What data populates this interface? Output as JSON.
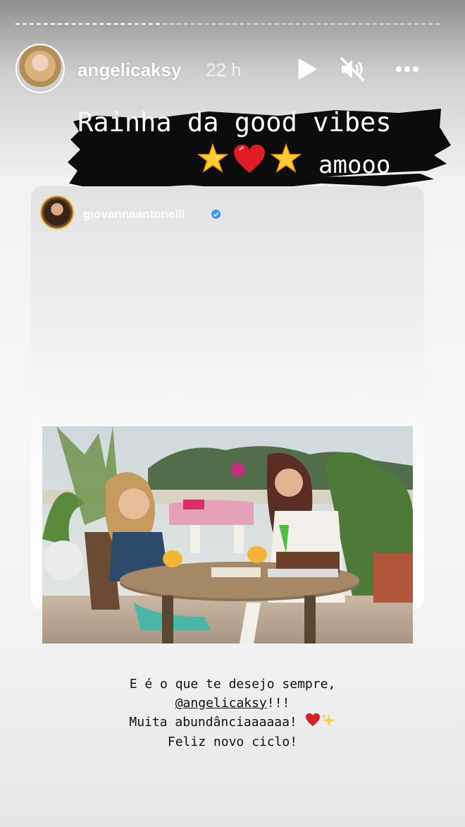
{
  "story": {
    "username": "angelicaksy",
    "time_ago": "22 h",
    "controls": {
      "play_icon": "play-icon",
      "mute_icon": "speaker-muted-icon",
      "more_icon": "more-dots-icon"
    }
  },
  "sticker": {
    "line1": "Rainha da good vibes",
    "line2": "amooo",
    "emojis": [
      "star-icon",
      "heart-icon",
      "star-icon"
    ]
  },
  "shared_post": {
    "username": "giovannaantonelli",
    "verified": true
  },
  "caption": {
    "line1": "E é o que te desejo sempre,",
    "mention": "@angelicaksy",
    "mention_suffix": "!!!",
    "line3": "Muita abundânciaaaaaa!",
    "line4": "Feliz novo ciclo!"
  }
}
